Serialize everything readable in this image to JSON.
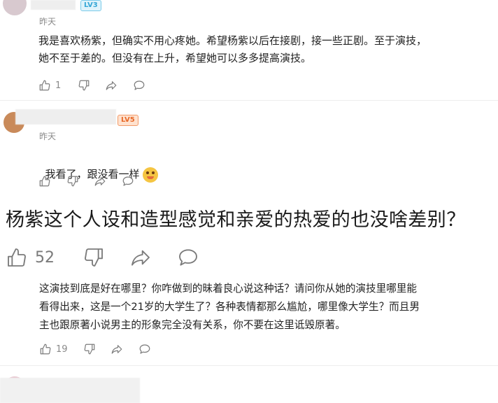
{
  "comments": [
    {
      "level": "LV3",
      "time": "昨天",
      "text": "我是喜欢杨紫，但确实不用心疼她。希望杨紫以后在接剧，接一些正剧。至于演技，\n她不至于差的。但没有在上升，希望她可以多多提高演技。",
      "likes": "1"
    },
    {
      "level": "LV5",
      "time": "昨天",
      "text": "我看了，跟没看一样",
      "emoji": "laughing-emoji"
    }
  ],
  "headline": {
    "text": "杨紫这个人设和造型感觉和亲爱的热爱的也没啥差别？",
    "likes": "52"
  },
  "reply": {
    "text": "这演技到底是好在哪里？你咋做到的昧着良心说这种话？请问你从她的演技里哪里能\n看得出来，这是一个21岁的大学生了？各种表情都那么尴尬，哪里像大学生？而且男\n主也跟原著小说男主的形象完全没有关系，你不要在这里诋毁原著。",
    "likes": "19"
  },
  "icons": [
    "thumbs-up-icon",
    "thumbs-down-icon",
    "share-icon",
    "comment-icon",
    "more-icon"
  ],
  "colors": {
    "lv3": "#36a7d6",
    "lv5": "#e86a2a",
    "icon": "#7b7b7b"
  }
}
